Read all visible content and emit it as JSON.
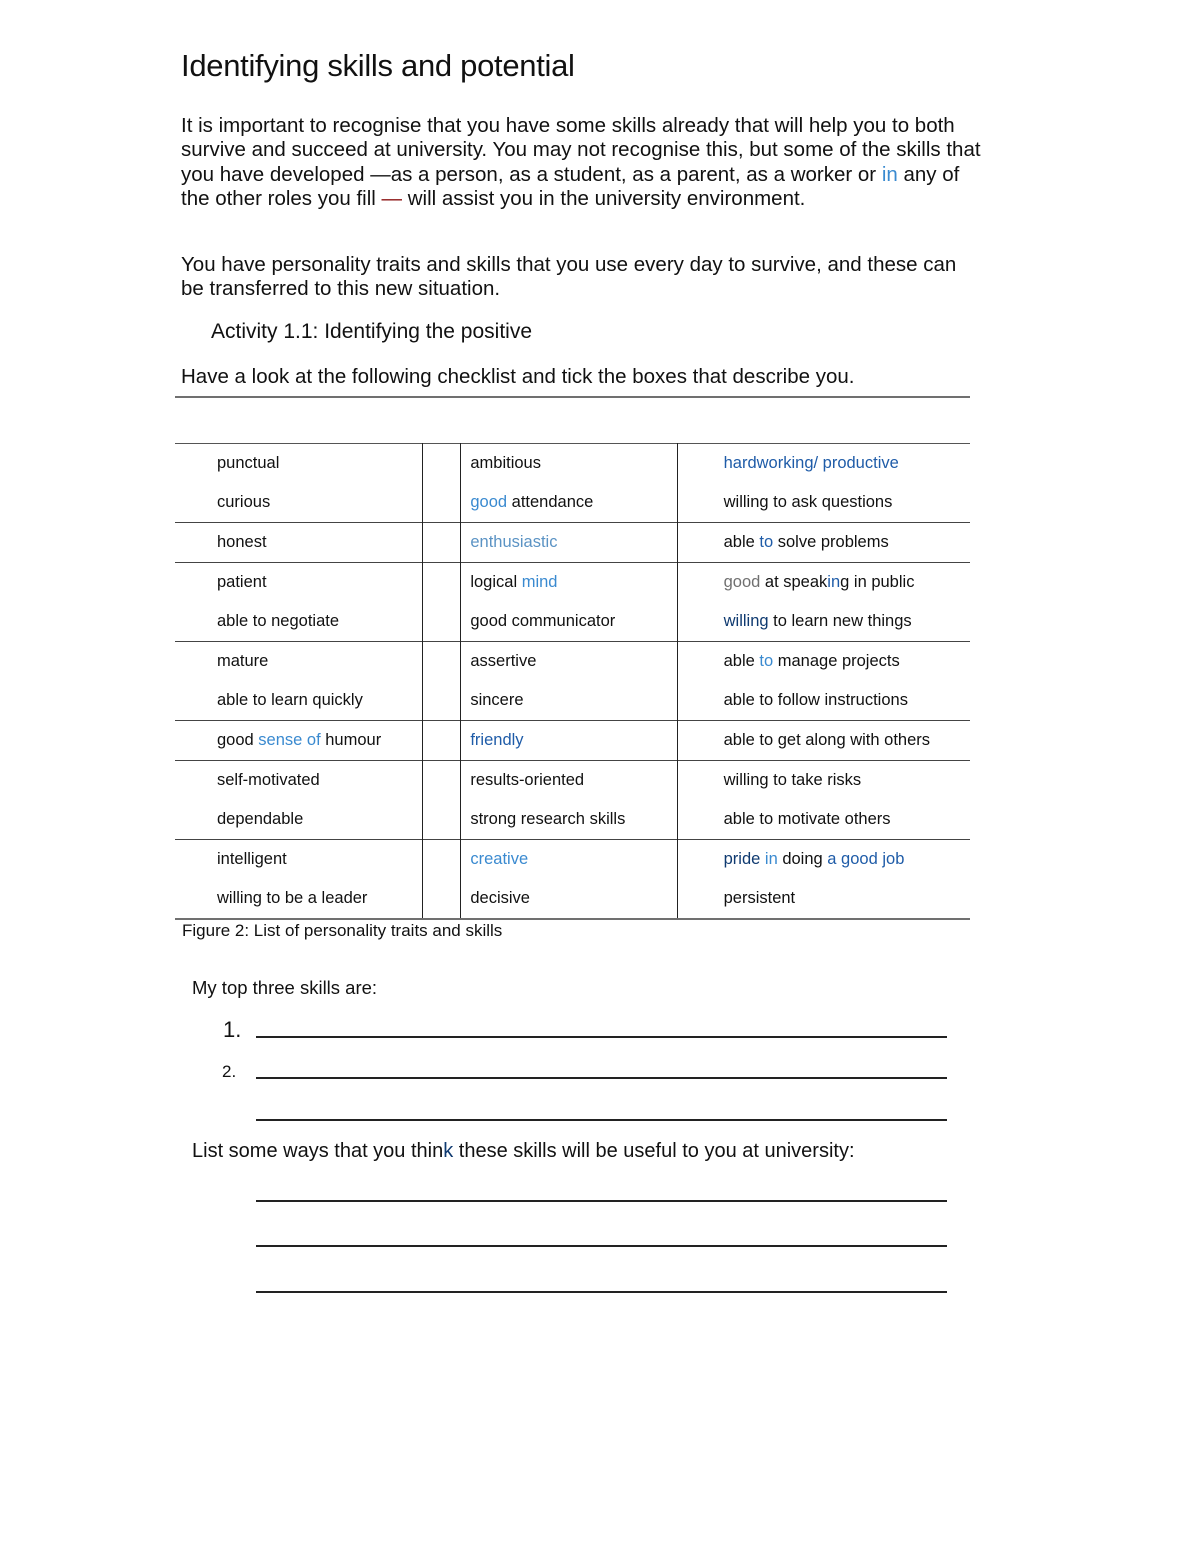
{
  "document": {
    "title": "Identifying skills and potential",
    "intro_paragraph": {
      "part1": "It is important to recognise that you have some skills already that will help you to both survive and succeed at university. You may not recognise this, but some of the skills that you have developed —as a person, as a student, as a parent, as a worker or ",
      "highlight_in": "in",
      "part2": " any of the other roles you fill ",
      "dash": "—",
      "part3": " will assist you in the university environment."
    },
    "second_paragraph": "You have personality traits and skills that you use every day to survive, and these can be transferred to this new  situation.",
    "activity_heading": "Activity 1.1: Identifying the positive",
    "instruction": "Have a look at the following checklist and tick the boxes that describe you.",
    "table": {
      "rows": [
        {
          "col1": [
            "punctual",
            "curious"
          ],
          "col2": [
            "ambitious",
            "good attendance"
          ],
          "col3": [
            "hardworking/ productive",
            "willing to ask questions"
          ]
        },
        {
          "col1": [
            "honest"
          ],
          "col2": [
            "enthusiastic"
          ],
          "col3": [
            "able to solve problems"
          ]
        },
        {
          "col1": [
            "patient",
            "able to negotiate"
          ],
          "col2": [
            "logical mind",
            "good communicator"
          ],
          "col3": [
            "good at speaking in public",
            "willing to learn new things"
          ]
        },
        {
          "col1": [
            "mature",
            "able to learn quickly"
          ],
          "col2": [
            "assertive",
            "sincere"
          ],
          "col3": [
            "able to manage projects",
            "able to follow instructions"
          ]
        },
        {
          "col1": [
            "good sense of humour"
          ],
          "col2": [
            "friendly"
          ],
          "col3": [
            "able to get along with others"
          ]
        },
        {
          "col1": [
            "self-motivated",
            "dependable"
          ],
          "col2": [
            "results-oriented",
            "strong research skills"
          ],
          "col3": [
            "willing to take risks",
            "able to motivate others"
          ]
        },
        {
          "col1": [
            "intelligent",
            "willing to be a leader"
          ],
          "col2": [
            "creative",
            "decisive"
          ],
          "col3": [
            "pride in doing a good job",
            "persistent"
          ]
        }
      ]
    },
    "figure_caption": "Figure 2: List of personality traits and skills",
    "top_three_label": "My top three skills are:",
    "numbers": [
      "1.",
      "2."
    ],
    "list_ways_label": "List some ways that you think these skills will be useful to you at university:"
  }
}
